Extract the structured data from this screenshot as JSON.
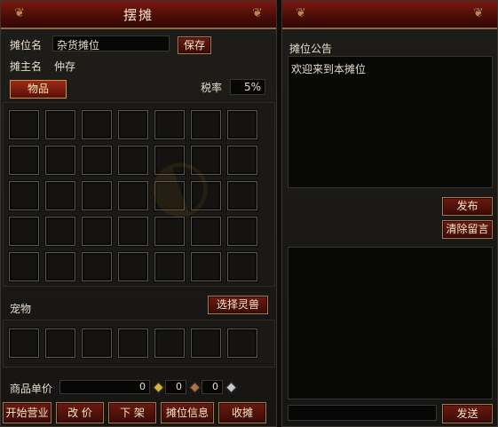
{
  "left_panel": {
    "title": "摆摊",
    "stall_name_label": "摊位名",
    "stall_name_value": "杂货摊位",
    "save_button": "保存",
    "owner_label": "摊主名",
    "owner_value": "仲存",
    "items_tab": "物品",
    "tax_label": "税率",
    "tax_value": "5%",
    "pet_label": "宠物",
    "select_pet_button": "选择灵兽",
    "price_label": "商品单价",
    "price_total": "0",
    "price_gold": "0",
    "price_copper": "0",
    "price_silver": "0",
    "buttons": {
      "start": "开始营业",
      "reprice": "改 价",
      "unlist": "下 架",
      "info": "摊位信息",
      "close": "收摊"
    }
  },
  "right_panel": {
    "notice_title": "摊位公告",
    "notice_text": "欢迎来到本摊位",
    "publish_button": "发布",
    "clear_button": "清除留言",
    "send_button": "发送"
  },
  "colors": {
    "title_red": "#5a0f08",
    "gold_border": "#a2794a",
    "gold_coin": "#d9b23a",
    "copper_coin": "#b07040",
    "silver_coin": "#c8c8c8"
  },
  "icons": {
    "gold_coin": "gold-coin-icon",
    "copper_coin": "copper-coin-icon",
    "silver_coin": "silver-coin-icon"
  }
}
